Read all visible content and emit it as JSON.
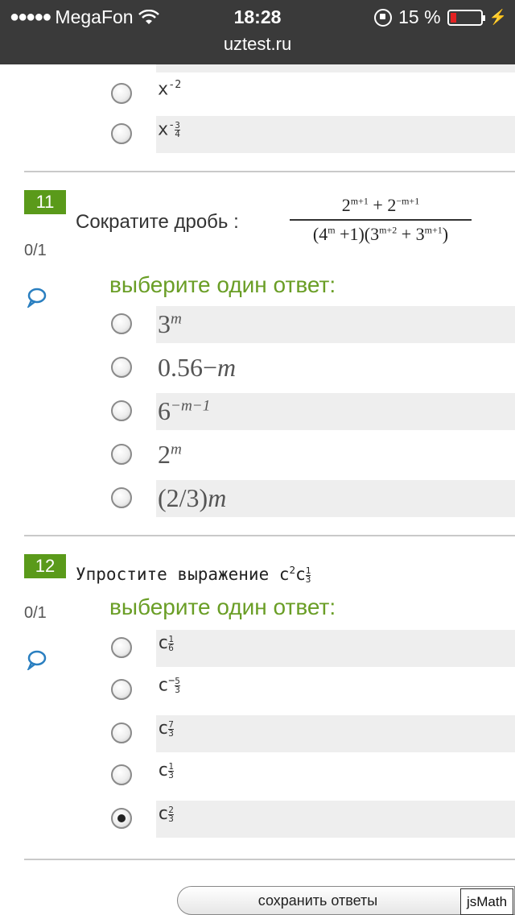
{
  "status_bar": {
    "carrier": "MegaFon",
    "time": "18:28",
    "battery": "15 %",
    "url": "uztest.ru",
    "battery_color": "#e32222"
  },
  "previous_options": [
    {
      "base": "x",
      "exp": "-2"
    },
    {
      "base": "x",
      "exp_sign": "-",
      "exp_num": "3",
      "exp_den": "4"
    }
  ],
  "q11": {
    "number": "11",
    "score": "0/1",
    "text": "Сократите дробь :",
    "choose_label": "выберите один ответ:",
    "options": [
      {
        "base": "3",
        "exp": "m"
      },
      {
        "base": "0.56−",
        "exp": "",
        "tail": "m"
      },
      {
        "base": "6",
        "exp": "−m−1"
      },
      {
        "base": "2",
        "exp": "m"
      },
      {
        "base": "(2/3)",
        "exp": "",
        "tail": "m"
      }
    ]
  },
  "q12": {
    "number": "12",
    "score": "0/1",
    "text": "Упростите выражение",
    "choose_label": "выберите один ответ:",
    "options": [
      {
        "base": "c",
        "num": "1",
        "den": "6",
        "sign": ""
      },
      {
        "base": "c",
        "num": "5",
        "den": "3",
        "sign": "−"
      },
      {
        "base": "c",
        "num": "7",
        "den": "3",
        "sign": ""
      },
      {
        "base": "c",
        "num": "1",
        "den": "3",
        "sign": ""
      },
      {
        "base": "c",
        "num": "2",
        "den": "3",
        "sign": "",
        "selected": true
      }
    ]
  },
  "footer": {
    "save_label": "сохранить ответы",
    "jsmath_label": "jsMath"
  },
  "colors": {
    "question_number_bg": "#5a9a1a",
    "choose_label": "#6a9e26",
    "comment_icon": "#2a7fc0"
  }
}
